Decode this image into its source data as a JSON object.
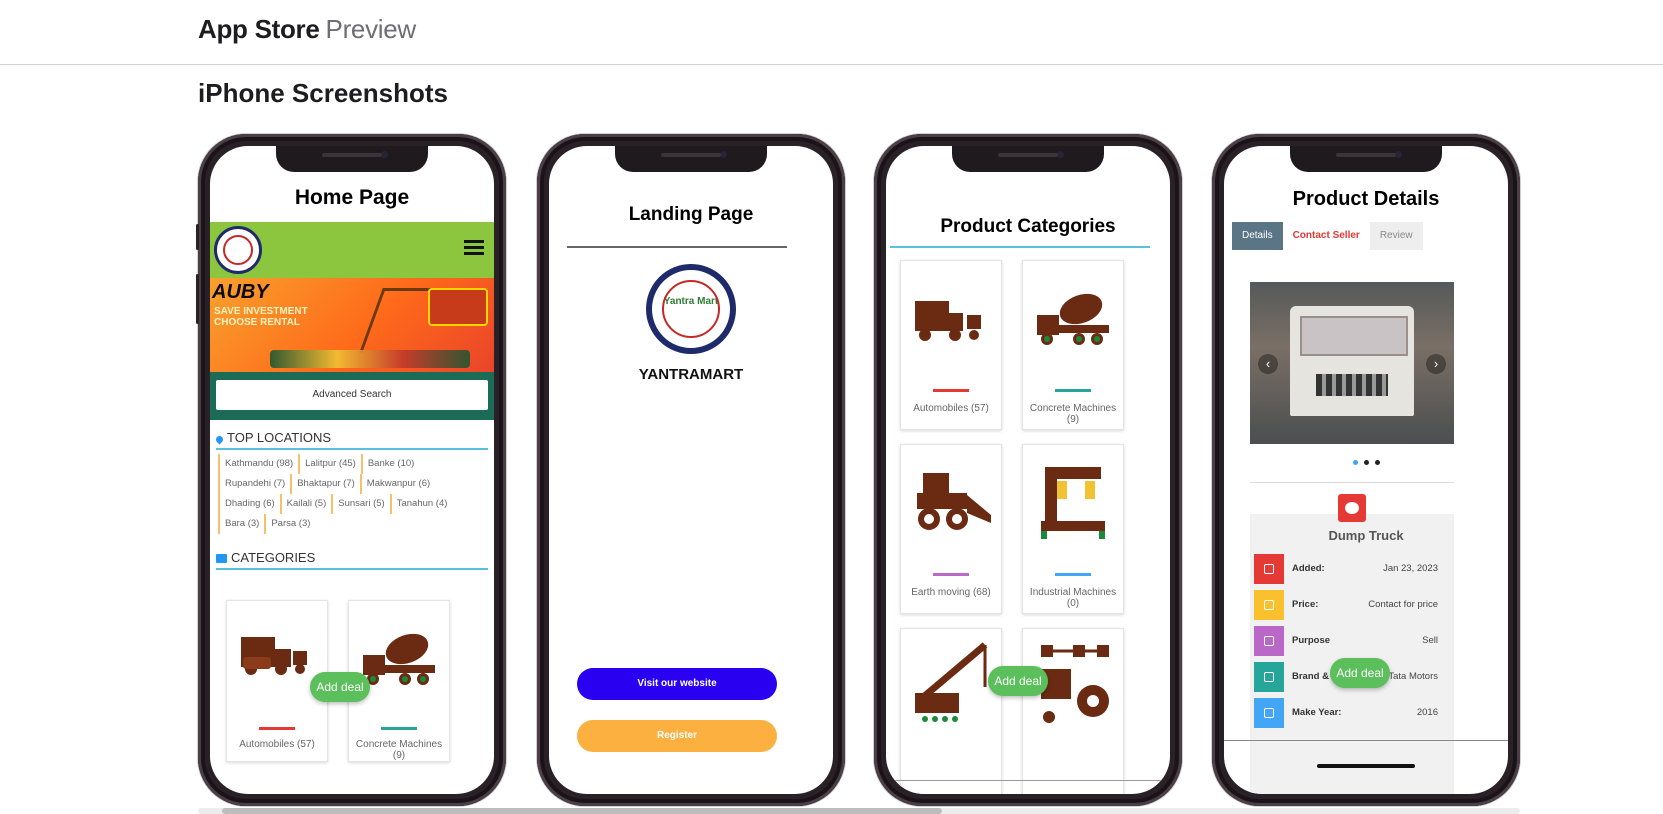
{
  "header": {
    "store": "App Store",
    "suffix": "Preview"
  },
  "section_title": "iPhone Screenshots",
  "screens": {
    "home": {
      "title": "Home Page",
      "banner_brand": "AUBY",
      "banner_line1": "SAVE INVESTMENT",
      "banner_line2": "CHOOSE RENTAL",
      "advanced_search": "Advanced Search",
      "top_locations": "TOP LOCATIONS",
      "locations": [
        [
          "Kathmandu (98)",
          "Lalitpur (45)",
          "Banke (10)"
        ],
        [
          "Rupandehi (7)",
          "Bhaktapur (7)",
          "Makwanpur (6)"
        ],
        [
          "Dhading (6)",
          "Kailali (5)",
          "Sunsari (5)",
          "Tanahun (4)"
        ],
        [
          "Bara (3)",
          "Parsa (3)"
        ]
      ],
      "categories": "CATEGORIES",
      "cards": [
        "Automobiles (57)",
        "Concrete Machines (9)"
      ],
      "add_deal": "Add deal"
    },
    "landing": {
      "title": "Landing Page",
      "logo_text": "Yantra Mart",
      "brand": "YANTRAMART",
      "visit": "Visit our website",
      "register": "Register"
    },
    "categories": {
      "title": "Product Categories",
      "cards": [
        "Automobiles (57)",
        "Concrete Machines (9)",
        "Earth moving (68)",
        "Industrial Machines (0)"
      ],
      "add_deal": "Add deal"
    },
    "details": {
      "title": "Product Details",
      "tabs": [
        "Details",
        "Contact  Seller",
        "Review"
      ],
      "product_name": "Dump Truck",
      "rows": [
        {
          "k": "Added:",
          "v": "Jan 23, 2023",
          "color": "#e53935"
        },
        {
          "k": "Price:",
          "v": "Contact for price",
          "color": "#fbc02d"
        },
        {
          "k": "Purpose",
          "v": "Sell",
          "color": "#ba68c8"
        },
        {
          "k": "Brand &",
          "v": "Tata Motors",
          "color": "#26a69a"
        },
        {
          "k": "Make Year:",
          "v": "2016",
          "color": "#42a5f5"
        }
      ],
      "add_deal": "Add deal"
    }
  },
  "colors": {
    "visit": "#2a00f0",
    "register": "#fbb040",
    "green_bar": "#8cc63f"
  }
}
